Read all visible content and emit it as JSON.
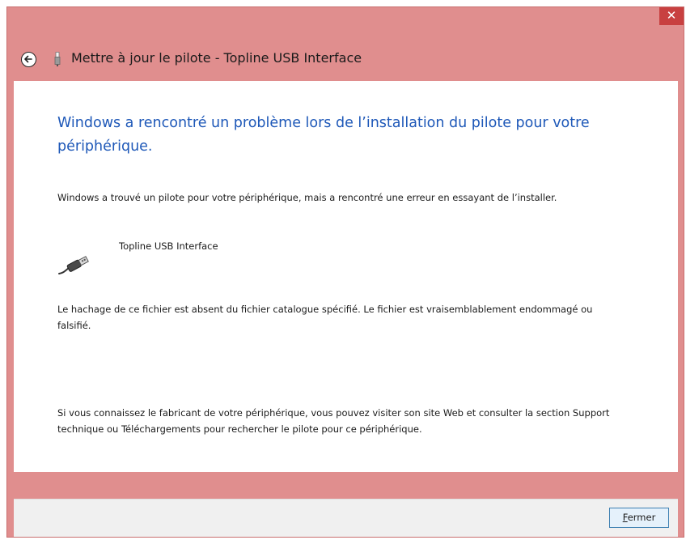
{
  "window": {
    "close_glyph": "✕",
    "title": "Mettre à jour le pilote - Topline USB Interface",
    "back_icon": "back-arrow-icon",
    "title_icon": "usb-plug-icon"
  },
  "content": {
    "heading": "Windows a rencontré un problème lors de l’installation du pilote pour votre périphérique.",
    "intro": "Windows a trouvé un pilote pour votre périphérique, mais a rencontré une erreur en essayant de l’installer.",
    "device": {
      "icon": "usb-cable-icon",
      "name": "Topline USB Interface"
    },
    "error_detail": "Le hachage de ce fichier est absent du fichier catalogue spécifié. Le fichier est vraisemblablement endommagé ou falsifié.",
    "help_text": "Si vous connaissez le fabricant de votre périphérique, vous pouvez visiter son site Web et consulter la section Support technique ou Téléchargements pour rechercher le pilote pour ce périphérique."
  },
  "footer": {
    "close_button_mnemonic": "F",
    "close_button_rest": "ermer"
  },
  "colors": {
    "chrome": "#e08e8e",
    "close_button_bg": "#c84040",
    "heading": "#1e58b8",
    "footer_bg": "#f0f0f0",
    "button_border": "#3c7fb1"
  }
}
